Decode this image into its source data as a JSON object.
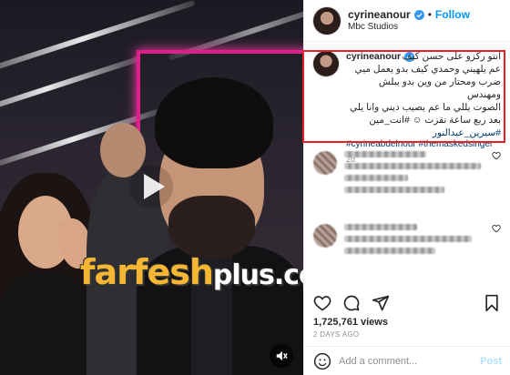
{
  "post": {
    "username": "cyrineanour",
    "follow_label": "Follow",
    "separator": "•",
    "location": "Mbc Studios"
  },
  "caption": {
    "username": "cyrineanour",
    "line1": "انتو ركزو على حسن كيف",
    "lines": [
      "عم يلهيني وحمدي كيف بدو يعمل ميي",
      "ضرب ومحتار من وين بدو يبلش ومهندس",
      "الصوت يللي ما عم يصيب ديني وانا يلي",
      "بعد ربع ساعة نقزت ☺ #انت_مين"
    ],
    "hashtag1": "#سيرين_عبدالنور",
    "hashtag2": "#cyrineabdelnour #themaskedsinger",
    "time": "2d"
  },
  "stats": {
    "views": "1,725,761 views",
    "ago": "2 DAYS AGO"
  },
  "comment_box": {
    "placeholder": "Add a comment...",
    "post_label": "Post"
  },
  "watermark": {
    "part1": "farfesh",
    "part2": "plus",
    "part3": ".com"
  },
  "colors": {
    "follow": "#0095f6",
    "highlight_border": "#e2222a",
    "hashtag": "#00376b",
    "watermark_gold": "#f5b733"
  }
}
